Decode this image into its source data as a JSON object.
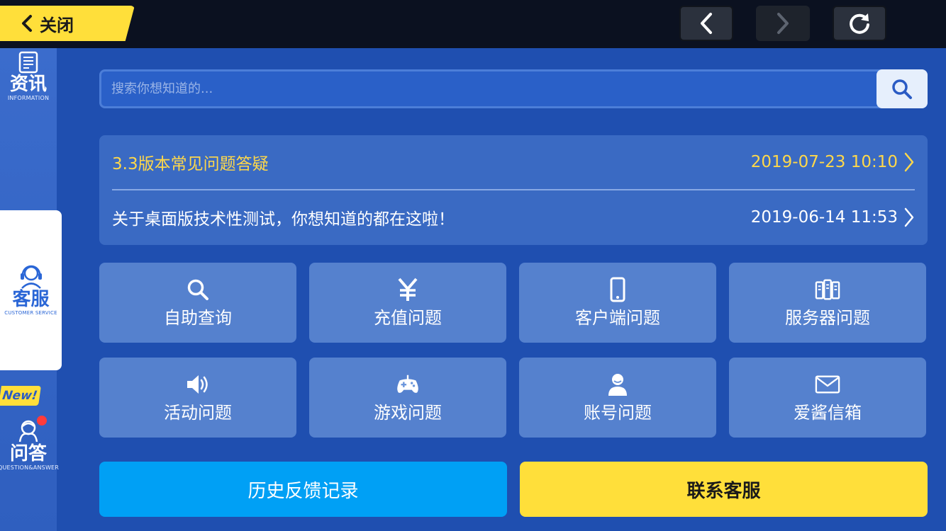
{
  "topbar": {
    "close_label": "关闭",
    "icons": [
      "chevron-left-icon",
      "back-arrow-icon",
      "forward-arrow-icon",
      "refresh-icon"
    ]
  },
  "sidebar": {
    "items": [
      {
        "title": "资讯",
        "subtitle": "INFORMATION",
        "icon": "document-icon",
        "active": false
      },
      {
        "title": "客服",
        "subtitle": "CUSTOMER SERVICE",
        "icon": "headset-icon",
        "active": true
      },
      {
        "title": "问答",
        "subtitle": "QUESTION&ANSWER",
        "icon": "qa-icon",
        "active": false
      }
    ],
    "new_badge": "New!"
  },
  "search": {
    "placeholder": "搜索你想知道的...",
    "value": ""
  },
  "news": [
    {
      "title": "3.3版本常见问题答疑",
      "date": "2019-07-23 10:10"
    },
    {
      "title": "关于桌面版技术性测试，你想知道的都在这啦！",
      "date": "2019-06-14 11:53"
    }
  ],
  "tiles": [
    {
      "label": "自助查询",
      "icon": "search-icon"
    },
    {
      "label": "充值问题",
      "icon": "yen-icon"
    },
    {
      "label": "客户端问题",
      "icon": "phone-icon"
    },
    {
      "label": "服务器问题",
      "icon": "server-icon"
    },
    {
      "label": "活动问题",
      "icon": "speaker-icon"
    },
    {
      "label": "游戏问题",
      "icon": "gamepad-icon"
    },
    {
      "label": "账号问题",
      "icon": "user-icon"
    },
    {
      "label": "爱酱信箱",
      "icon": "mail-icon"
    }
  ],
  "actions": {
    "history_label": "历史反馈记录",
    "contact_label": "联系客服"
  },
  "colors": {
    "accent_yellow": "#ffdf3a",
    "accent_blue": "#00a0f5",
    "background": "#1f4fb0"
  }
}
